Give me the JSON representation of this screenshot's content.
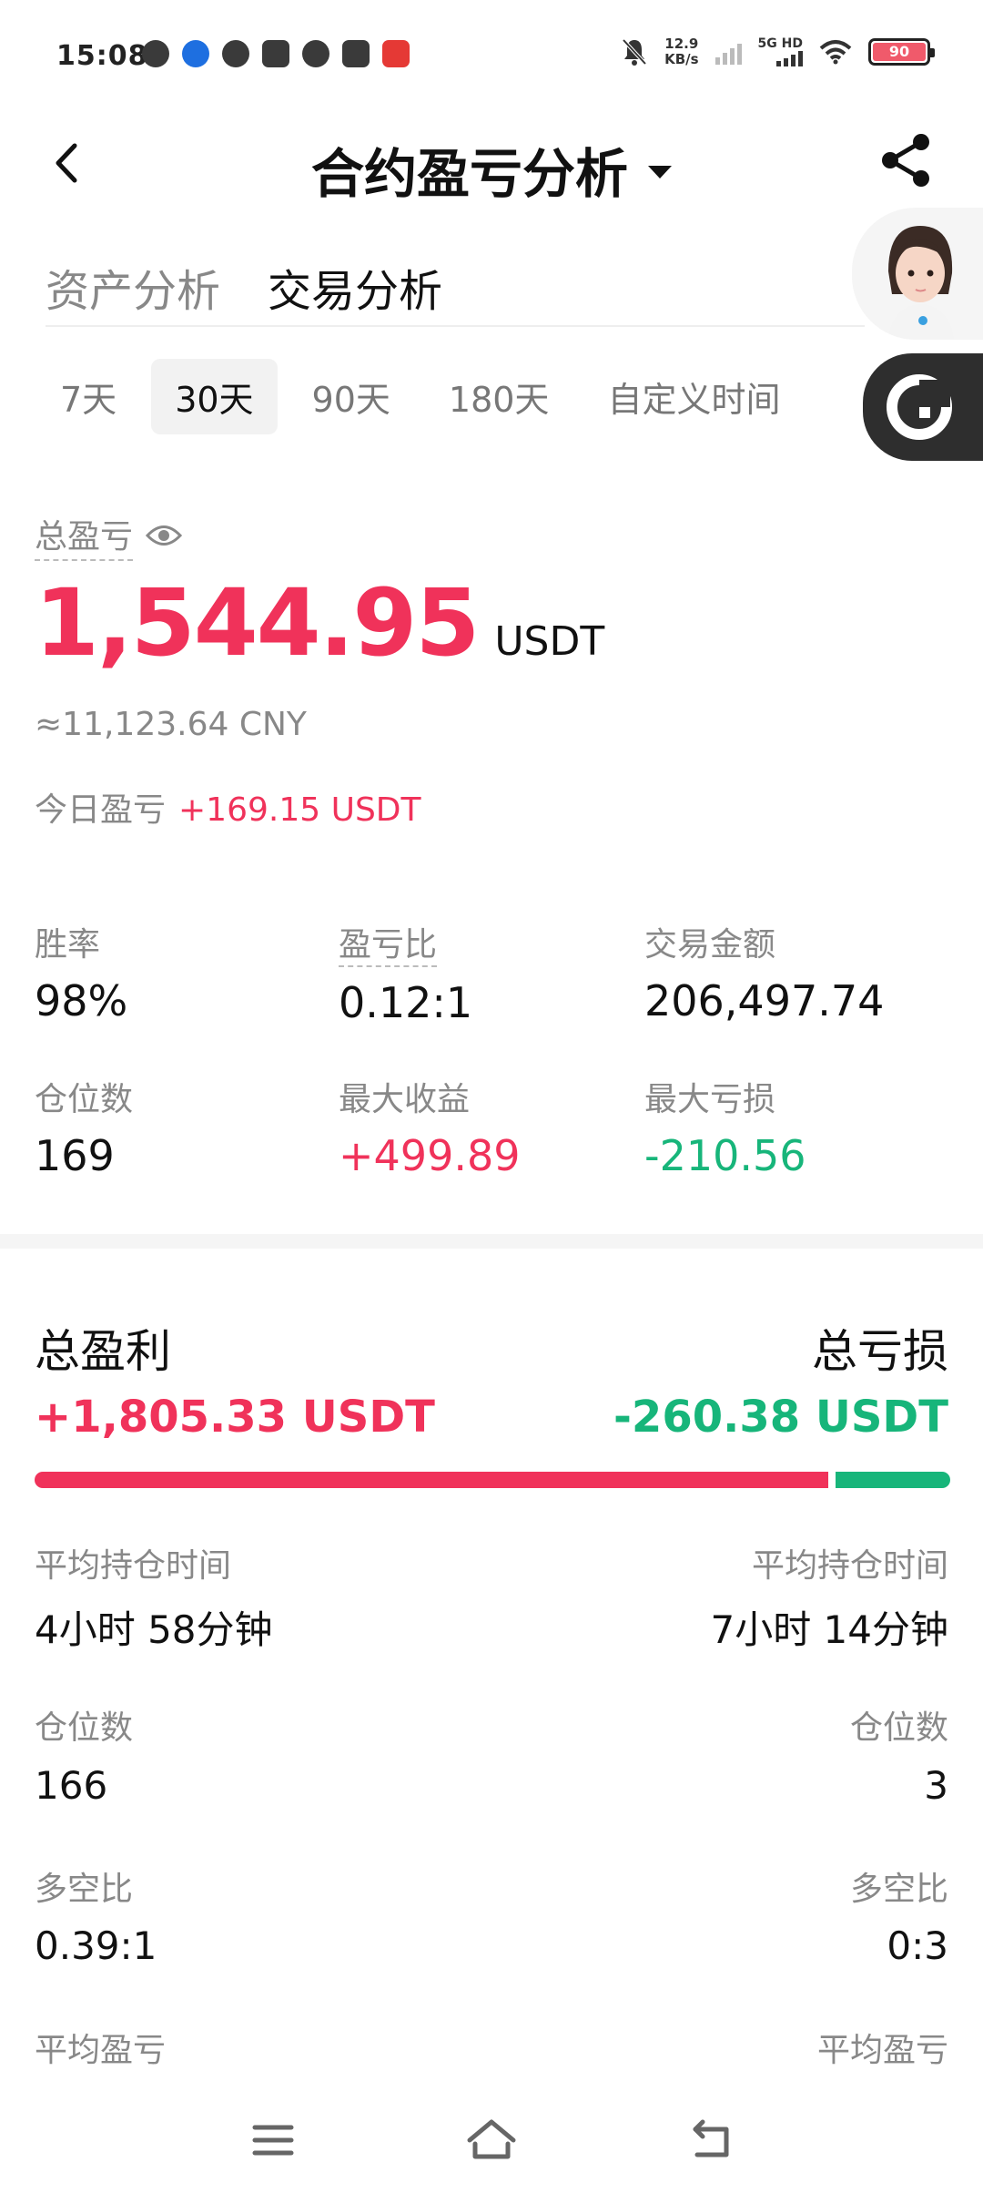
{
  "status_bar": {
    "time": "15:08",
    "net_speed_value": "12.9",
    "net_speed_unit": "KB/s",
    "network": "5G HD",
    "battery": "90"
  },
  "header": {
    "title": "合约盈亏分析"
  },
  "tabs": [
    {
      "label": "资产分析",
      "active": false
    },
    {
      "label": "交易分析",
      "active": true
    }
  ],
  "periods": [
    {
      "label": "7天",
      "active": false
    },
    {
      "label": "30天",
      "active": true
    },
    {
      "label": "90天",
      "active": false
    },
    {
      "label": "180天",
      "active": false
    },
    {
      "label": "自定义时间",
      "active": false
    }
  ],
  "total": {
    "label": "总盈亏",
    "value": "1,544.95",
    "unit": "USDT",
    "cny": "≈11,123.64 CNY",
    "today_label": "今日盈亏",
    "today_value": "+169.15 USDT"
  },
  "stats": {
    "win_rate": {
      "label": "胜率",
      "value": "98%"
    },
    "pl_ratio": {
      "label": "盈亏比",
      "value": "0.12:1"
    },
    "volume": {
      "label": "交易金额",
      "value": "206,497.74"
    },
    "positions": {
      "label": "仓位数",
      "value": "169"
    },
    "max_profit": {
      "label": "最大收益",
      "value": "+499.89"
    },
    "max_loss": {
      "label": "最大亏损",
      "value": "-210.56"
    }
  },
  "profit_loss": {
    "profit_label": "总盈利",
    "profit_value": "+1,805.33 USDT",
    "loss_label": "总亏损",
    "loss_value": "-260.38 USDT",
    "profit_share": 0.874,
    "profit": {
      "avg_hold_label": "平均持仓时间",
      "avg_hold_value": "4小时 58分钟",
      "positions_label": "仓位数",
      "positions_value": "166",
      "long_short_label": "多空比",
      "long_short_value": "0.39:1",
      "avg_pl_label": "平均盈亏"
    },
    "loss": {
      "avg_hold_label": "平均持仓时间",
      "avg_hold_value": "7小时 14分钟",
      "positions_label": "仓位数",
      "positions_value": "3",
      "long_short_label": "多空比",
      "long_short_value": "0:3",
      "avg_pl_label": "平均盈亏"
    }
  },
  "colors": {
    "profit": "#f0325a",
    "loss": "#17b57a"
  },
  "icons": {
    "back": "chevron-left-icon",
    "dropdown": "caret-down-icon",
    "share": "share-icon",
    "eye": "eye-icon",
    "menu": "menu-icon",
    "home": "home-icon",
    "back_nav": "return-icon"
  }
}
